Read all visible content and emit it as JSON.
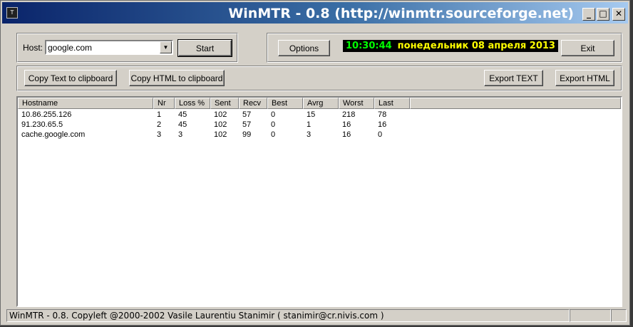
{
  "window": {
    "title": "WinMTR - 0.8 (http://winmtr.sourceforge.net)",
    "icon": "app-icon",
    "controls": {
      "minimize": "_",
      "maximize": "□",
      "close": "✕"
    }
  },
  "host": {
    "label": "Host:",
    "value": "google.com",
    "start_label": "Start"
  },
  "options": {
    "options_label": "Options",
    "clock_time": "10:30:44",
    "clock_date": "понедельник 08 апреля 2013",
    "exit_label": "Exit"
  },
  "export": {
    "copy_text_label": "Copy Text to clipboard",
    "copy_html_label": "Copy HTML to clipboard",
    "export_text_label": "Export TEXT",
    "export_html_label": "Export HTML"
  },
  "table": {
    "columns": [
      "Hostname",
      "Nr",
      "Loss %",
      "Sent",
      "Recv",
      "Best",
      "Avrg",
      "Worst",
      "Last"
    ],
    "rows": [
      [
        "10.86.255.126",
        "1",
        "45",
        "102",
        "57",
        "0",
        "15",
        "218",
        "78"
      ],
      [
        "91.230.65.5",
        "2",
        "45",
        "102",
        "57",
        "0",
        "1",
        "16",
        "16"
      ],
      [
        "cache.google.com",
        "3",
        "3",
        "102",
        "99",
        "0",
        "3",
        "16",
        "0"
      ]
    ]
  },
  "status": {
    "text": "WinMTR - 0.8. Copyleft @2000-2002 Vasile Laurentiu Stanimir  ( stanimir@cr.nivis.com )"
  },
  "colors": {
    "title_bar": "#0a246a",
    "clock_time": "#00ff00",
    "clock_date": "#ffff00"
  }
}
